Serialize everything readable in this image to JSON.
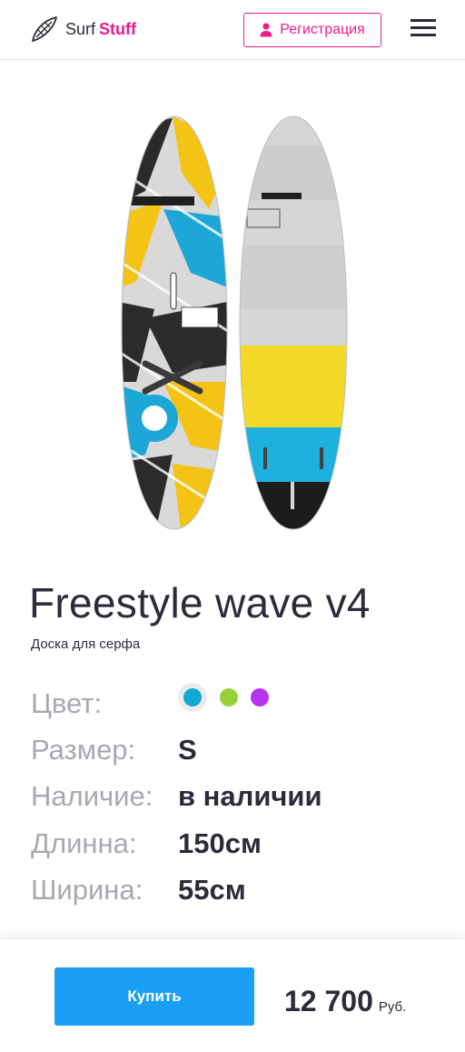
{
  "header": {
    "logo_left": "Surf",
    "logo_right": "Stuff",
    "register_label": "Регистрация",
    "brand_color": "#ec1c8d",
    "icons": [
      "surfboard-logo-icon",
      "user-icon",
      "hamburger-menu-icon"
    ]
  },
  "product": {
    "title": "Freestyle wave v4",
    "subtitle": "Доска для серфа",
    "image": "two-windsurf-boards"
  },
  "specs": {
    "color_label": "Цвет:",
    "colors": [
      "#13a7d4",
      "#98d135",
      "#b832f0"
    ],
    "selected_color": "#13a7d4",
    "size_label": "Размер:",
    "size_value": "S",
    "availability_label": "Наличие:",
    "availability_value": "в наличии",
    "length_label": "Длинна:",
    "length_value": "150см",
    "width_label": "Ширина:",
    "width_value": "55см"
  },
  "purchase": {
    "buy_label": "Купить",
    "price": "12 700",
    "currency": "Руб.",
    "button_color": "#1a9ff4"
  }
}
